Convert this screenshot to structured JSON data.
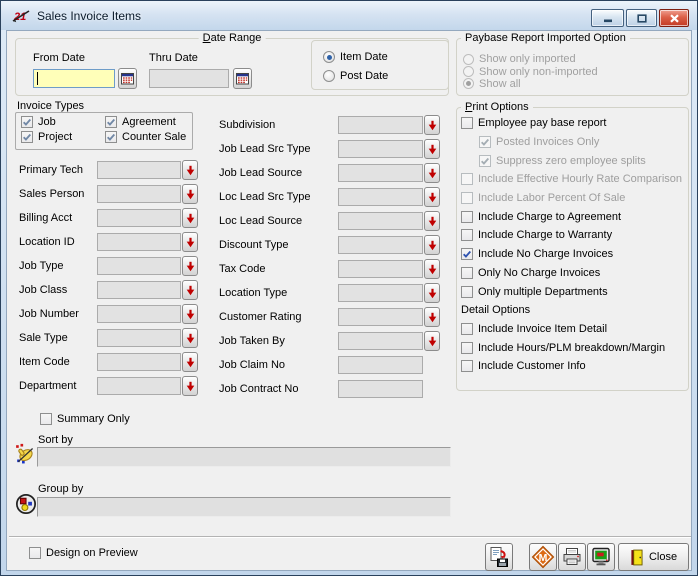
{
  "window": {
    "title": "Sales Invoice Items",
    "icon": "logo-21",
    "controls": [
      "minimize",
      "maximize",
      "close"
    ]
  },
  "date_range": {
    "label": {
      "text": "Date Range",
      "accel": "D"
    },
    "from_date": {
      "label": "From Date",
      "value": "",
      "focused": true
    },
    "thru_date": {
      "label": "Thru Date",
      "value": ""
    },
    "date_type_options": [
      {
        "label": "Item Date",
        "selected": true
      },
      {
        "label": "Post Date",
        "selected": false
      }
    ]
  },
  "paybase_options": {
    "label": "Paybase Report Imported Option",
    "options": [
      {
        "label": "Show only imported",
        "selected": false,
        "disabled": true
      },
      {
        "label": "Show only non-imported",
        "selected": false,
        "disabled": true
      },
      {
        "label": "Show all",
        "selected": true,
        "disabled": true
      }
    ]
  },
  "invoice_types": {
    "label": "Invoice Types",
    "options": [
      {
        "label": "Job",
        "checked": true,
        "muted": true
      },
      {
        "label": "Agreement",
        "checked": true,
        "muted": true
      },
      {
        "label": "Project",
        "checked": true,
        "muted": true
      },
      {
        "label": "Counter Sale",
        "checked": true,
        "muted": true
      }
    ]
  },
  "filters_left": [
    {
      "label": "Primary Tech",
      "value": "",
      "dropdown": true
    },
    {
      "label": "Sales Person",
      "value": "",
      "dropdown": true
    },
    {
      "label": "Billing Acct",
      "value": "",
      "dropdown": true
    },
    {
      "label": "Location ID",
      "value": "",
      "dropdown": true
    },
    {
      "label": "Job Type",
      "value": "",
      "dropdown": true
    },
    {
      "label": "Job Class",
      "value": "",
      "dropdown": true
    },
    {
      "label": "Job Number",
      "value": "",
      "dropdown": true
    },
    {
      "label": "Sale Type",
      "value": "",
      "dropdown": true
    },
    {
      "label": "Item Code",
      "value": "",
      "dropdown": true
    },
    {
      "label": "Department",
      "value": "",
      "dropdown": true
    }
  ],
  "filters_middle": [
    {
      "label": "Subdivision",
      "value": "",
      "dropdown": true
    },
    {
      "label": "Job Lead Src Type",
      "value": "",
      "dropdown": true
    },
    {
      "label": "Job Lead Source",
      "value": "",
      "dropdown": true
    },
    {
      "label": "Loc Lead Src Type",
      "value": "",
      "dropdown": true
    },
    {
      "label": "Loc Lead Source",
      "value": "",
      "dropdown": true
    },
    {
      "label": "Discount Type",
      "value": "",
      "dropdown": true
    },
    {
      "label": "Tax Code",
      "value": "",
      "dropdown": true
    },
    {
      "label": "Location Type",
      "value": "",
      "dropdown": true
    },
    {
      "label": "Customer Rating",
      "value": "",
      "dropdown": true
    },
    {
      "label": "Job Taken By",
      "value": "",
      "dropdown": true
    },
    {
      "label": "Job Claim No",
      "value": "",
      "dropdown": false
    },
    {
      "label": "Job Contract No",
      "value": "",
      "dropdown": false
    }
  ],
  "print_options": {
    "label": {
      "text": "Print Options",
      "accel": "P"
    },
    "items": [
      {
        "label": "Employee pay base report",
        "checked": false,
        "disabled": false,
        "indent": 0
      },
      {
        "label": "Posted Invoices Only",
        "checked": true,
        "disabled": true,
        "indent": 1
      },
      {
        "label": "Suppress zero employee splits",
        "checked": true,
        "disabled": true,
        "indent": 1
      },
      {
        "label": "Include Effective Hourly Rate Comparison",
        "checked": false,
        "disabled": true,
        "indent": 0
      },
      {
        "label": "Include Labor Percent Of Sale",
        "checked": false,
        "disabled": true,
        "indent": 0
      },
      {
        "label": "Include Charge to Agreement",
        "checked": false,
        "disabled": false,
        "indent": 0
      },
      {
        "label": "Include Charge to Warranty",
        "checked": false,
        "disabled": false,
        "indent": 0
      },
      {
        "label": "Include No Charge Invoices",
        "checked": true,
        "disabled": false,
        "indent": 0
      },
      {
        "label": "Only No Charge Invoices",
        "checked": false,
        "disabled": false,
        "indent": 0
      },
      {
        "label": "Only multiple Departments",
        "checked": false,
        "disabled": false,
        "indent": 0
      }
    ],
    "detail_heading": "Detail Options",
    "detail_items": [
      {
        "label": "Include Invoice Item Detail",
        "checked": false,
        "disabled": false,
        "indent": 0
      },
      {
        "label": "Include Hours/PLM breakdown/Margin",
        "checked": false,
        "disabled": false,
        "indent": 0
      },
      {
        "label": "Include Customer Info",
        "checked": false,
        "disabled": false,
        "indent": 0
      }
    ]
  },
  "summary_only": {
    "label": "Summary Only",
    "checked": false
  },
  "sort_by": {
    "label": "Sort by",
    "value": "",
    "icon": "sort-hand-icon"
  },
  "group_by": {
    "label": "Group by",
    "value": "",
    "icon": "group-circle-icon"
  },
  "footer": {
    "design_on_preview": {
      "label": "Design on Preview",
      "checked": false
    },
    "buttons": [
      {
        "name": "export-report",
        "icon": "report-to-file"
      },
      {
        "name": "m-diamond",
        "icon": "orange-m-diamond"
      },
      {
        "name": "print",
        "icon": "printer"
      },
      {
        "name": "preview",
        "icon": "monitor-preview"
      },
      {
        "name": "close",
        "icon": "exit-door",
        "label": "Close"
      }
    ]
  },
  "colors": {
    "titlebar_top": "#EDF4FB",
    "titlebar_bottom": "#C3D7EB",
    "frame_blue": "#C2D6EB",
    "body_bg": "#F0F0F0",
    "field_bg": "#E2E2E2",
    "focused_field_bg": "#FFFFB9",
    "check_accent": "#2F53B0",
    "dropdown_arrow_red": "#C00000",
    "close_window_red": "#C23A24"
  }
}
